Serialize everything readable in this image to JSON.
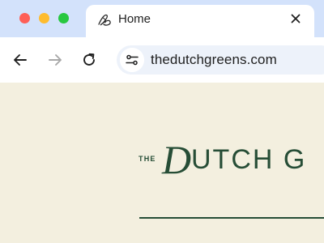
{
  "window": {
    "controls": [
      "close",
      "minimize",
      "zoom"
    ]
  },
  "tab": {
    "title": "Home",
    "favicon": "dutch-greens-monogram-icon",
    "close_icon": "close-icon"
  },
  "toolbar": {
    "back_icon": "arrow-left-icon",
    "forward_icon": "arrow-right-icon",
    "reload_icon": "reload-icon",
    "site_info_icon": "tune-icon",
    "url": "thedutchgreens.com"
  },
  "page": {
    "logo_small": "THE",
    "logo_initial": "D",
    "logo_rest": "UTCH G",
    "brand_color": "#264d36",
    "background_color": "#f3efdf"
  }
}
